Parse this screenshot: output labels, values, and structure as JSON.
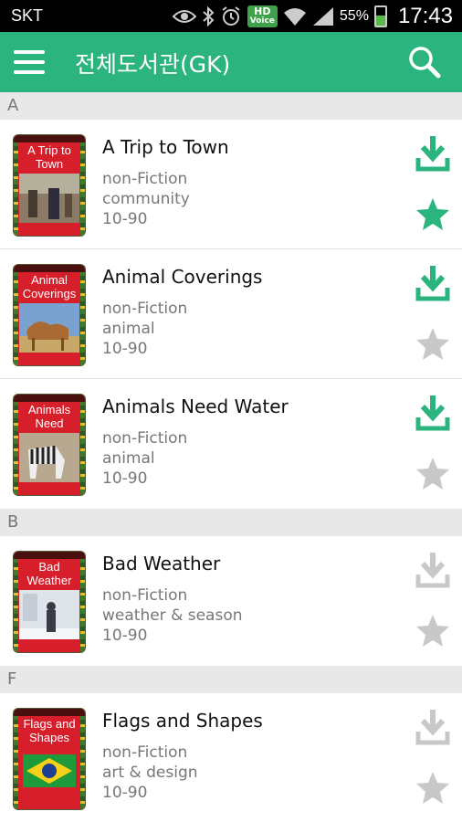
{
  "status_bar": {
    "carrier": "SKT",
    "hd_voice_top": "HD",
    "hd_voice_bottom": "Voice",
    "battery": "55%",
    "battery_level": 0.55,
    "time": "17:43"
  },
  "app_bar": {
    "title": "전체도서관(GK)",
    "color": "#2bb47d"
  },
  "colors": {
    "accent": "#2bb47d",
    "inactive": "#c8c8c8",
    "cover": "#d71e2b"
  },
  "sections": [
    {
      "letter": "A",
      "books": [
        {
          "title": "A Trip to Town",
          "cover_title": "A Trip to Town",
          "genre": "non-Fiction",
          "topic": "community",
          "level": "10-90",
          "downloaded": true,
          "favorite": true
        },
        {
          "title": "Animal Coverings",
          "cover_title": "Animal Coverings",
          "genre": "non-Fiction",
          "topic": "animal",
          "level": "10-90",
          "downloaded": true,
          "favorite": false
        },
        {
          "title": "Animals Need Water",
          "cover_title": "Animals Need Water",
          "genre": "non-Fiction",
          "topic": "animal",
          "level": "10-90",
          "downloaded": true,
          "favorite": false
        }
      ]
    },
    {
      "letter": "B",
      "books": [
        {
          "title": "Bad Weather",
          "cover_title": "Bad Weather",
          "genre": "non-Fiction",
          "topic": "weather & season",
          "level": "10-90",
          "downloaded": false,
          "favorite": false
        }
      ]
    },
    {
      "letter": "F",
      "books": [
        {
          "title": "Flags and Shapes",
          "cover_title": "Flags and Shapes",
          "genre": "non-Fiction",
          "topic": "art & design",
          "level": "10-90",
          "downloaded": false,
          "favorite": false
        }
      ]
    }
  ]
}
